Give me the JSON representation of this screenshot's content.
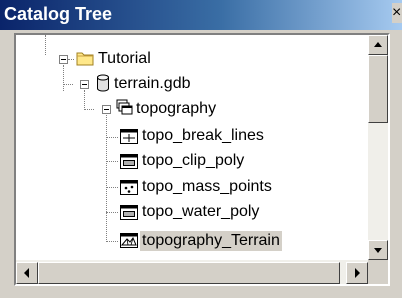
{
  "window": {
    "title": "Catalog Tree",
    "close_glyph": "×"
  },
  "tree": {
    "items": [
      {
        "label": "Tutorial",
        "icon": "folder-icon",
        "expanded": true
      },
      {
        "label": "terrain.gdb",
        "icon": "geodatabase-icon",
        "expanded": true
      },
      {
        "label": "topography",
        "icon": "feature-dataset-icon",
        "expanded": true
      },
      {
        "label": "topo_break_lines",
        "icon": "line-feature-class-icon"
      },
      {
        "label": "topo_clip_poly",
        "icon": "polygon-feature-class-icon"
      },
      {
        "label": "topo_mass_points",
        "icon": "point-feature-class-icon"
      },
      {
        "label": "topo_water_poly",
        "icon": "polygon-feature-class-icon"
      },
      {
        "label": "topography_Terrain",
        "icon": "terrain-icon",
        "selected": true
      }
    ]
  },
  "colors": {
    "titlebar_start": "#0a246a",
    "titlebar_end": "#a6caf0",
    "folder": "#ffe88a",
    "selected_bg": "#d4d0c8"
  }
}
